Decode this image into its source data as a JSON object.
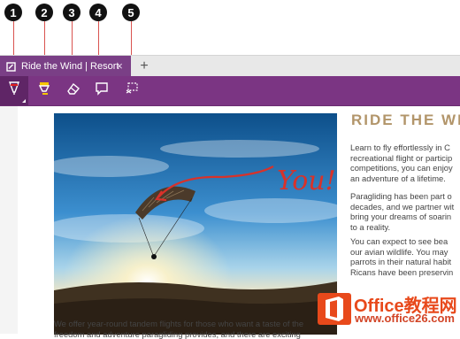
{
  "callouts": [
    "1",
    "2",
    "3",
    "4",
    "5"
  ],
  "tab": {
    "title": "Ride the Wind | Resort",
    "close": "×",
    "new_tab": "+"
  },
  "toolbar": {
    "tools": [
      {
        "name": "ballpoint-pen"
      },
      {
        "name": "highlighter"
      },
      {
        "name": "eraser"
      },
      {
        "name": "add-note"
      },
      {
        "name": "clip"
      }
    ]
  },
  "photo_annotation": {
    "text": "You!"
  },
  "article": {
    "title": "RIDE THE WIN",
    "paragraphs": [
      [
        "Learn to fly effortlessly in C",
        "recreational flight or particip",
        "competitions, you can enjoy",
        "an adventure of a lifetime."
      ],
      [
        "Paragliding has been part o",
        "decades, and we partner wit",
        "bring your dreams of soarin",
        "to a reality."
      ],
      [
        "You can expect to see bea",
        "our avian wildlife. You may",
        "parrots in their natural habit",
        "Ricans have been preservin"
      ]
    ],
    "below_photo": [
      "We offer year-round tandem flights for those who want a taste of the",
      "freedom and adventure paragliding provides, and there are exciting"
    ]
  },
  "watermark": {
    "brand": "Office教程网",
    "url": "www.office26.com"
  },
  "colors": {
    "accent": "#7b3583",
    "tab": "#7a3f86",
    "title": "#b2956a",
    "watermark": "#e8491b"
  }
}
